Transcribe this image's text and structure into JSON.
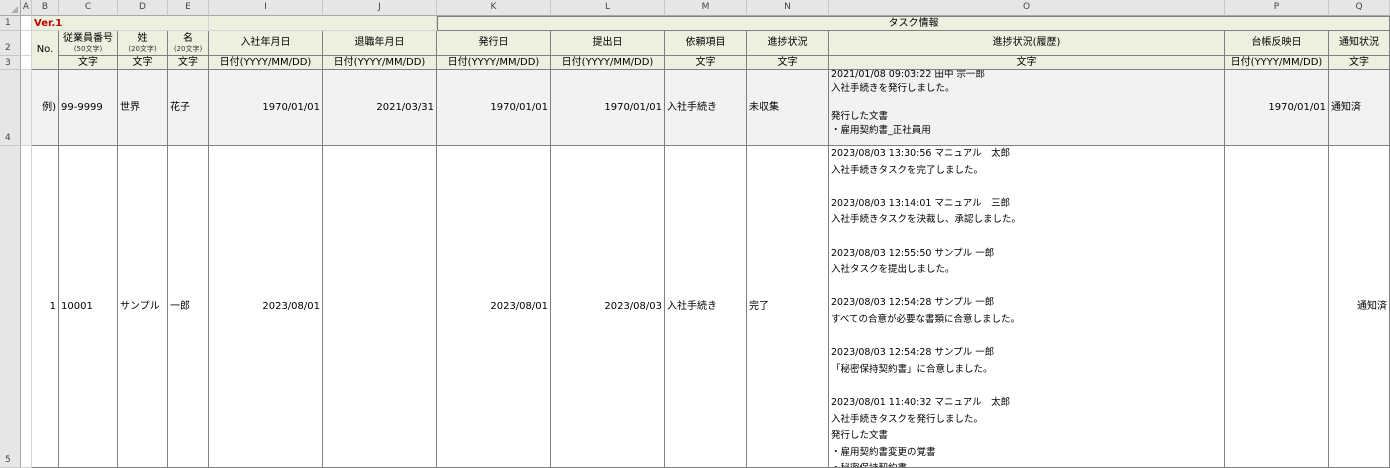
{
  "columns": [
    "A",
    "B",
    "C",
    "D",
    "E",
    "I",
    "J",
    "K",
    "L",
    "M",
    "N",
    "O",
    "P",
    "Q"
  ],
  "rows": [
    "1",
    "2",
    "3",
    "4",
    "5"
  ],
  "version": "Ver.1",
  "group_header": "タスク情報",
  "headers": {
    "no": "No.",
    "employee_id": "従業員番号",
    "employee_id_limit": "(50文字)",
    "last_name": "姓",
    "last_name_limit": "(20文字)",
    "first_name": "名",
    "first_name_limit": "(20文字)",
    "hire_date": "入社年月日",
    "retire_date": "退職年月日",
    "issue_date": "発行日",
    "submit_date": "提出日",
    "request_item": "依頼項目",
    "progress": "進捗状況",
    "progress_history": "進捗状況(履歴)",
    "ledger_date": "台帳反映日",
    "notice_status": "通知状況"
  },
  "types": {
    "employee_id": "文字",
    "last_name": "文字",
    "first_name": "文字",
    "hire_date": "日付(YYYY/MM/DD)",
    "retire_date": "日付(YYYY/MM/DD)",
    "issue_date": "日付(YYYY/MM/DD)",
    "submit_date": "日付(YYYY/MM/DD)",
    "request_item": "文字",
    "progress": "文字",
    "progress_history": "文字",
    "ledger_date": "日付(YYYY/MM/DD)",
    "notice_status": "文字"
  },
  "example_row": {
    "no": "例)",
    "employee_id": "99-9999",
    "last_name": "世界",
    "first_name": "花子",
    "hire_date": "1970/01/01",
    "retire_date": "2021/03/31",
    "issue_date": "1970/01/01",
    "submit_date": "1970/01/01",
    "request_item": "入社手続き",
    "progress": "未収集",
    "history": "2021/01/08 09:03:22 田中 宗一郎\n入社手続きを発行しました。\n\n発行した文書\n・雇用契約書_正社員用",
    "ledger_date": "1970/01/01",
    "notice_status": "通知済"
  },
  "data_row": {
    "no": "1",
    "employee_id": "10001",
    "last_name": "サンプル",
    "first_name": "一郎",
    "hire_date": "2023/08/01",
    "retire_date": "",
    "issue_date": "2023/08/01",
    "submit_date": "2023/08/03",
    "request_item": "入社手続き",
    "progress": "完了",
    "history": "2023/08/03 13:30:56 マニュアル　太郎\n入社手続きタスクを完了しました。\n\n2023/08/03 13:14:01 マニュアル　三郎\n入社手続きタスクを決裁し、承認しました。\n\n2023/08/03 12:55:50 サンプル 一郎\n入社タスクを提出しました。\n\n2023/08/03 12:54:28 サンプル 一郎\nすべての合意が必要な書類に合意しました。\n\n2023/08/03 12:54:28 サンプル 一郎\n「秘密保持契約書」に合意しました。\n\n2023/08/01 11:40:32 マニュアル　太郎\n入社手続きタスクを発行しました。\n発行した文書\n・雇用契約書変更の覚書\n・秘密保持契約書",
    "ledger_date": "",
    "notice_status": "通知済"
  }
}
